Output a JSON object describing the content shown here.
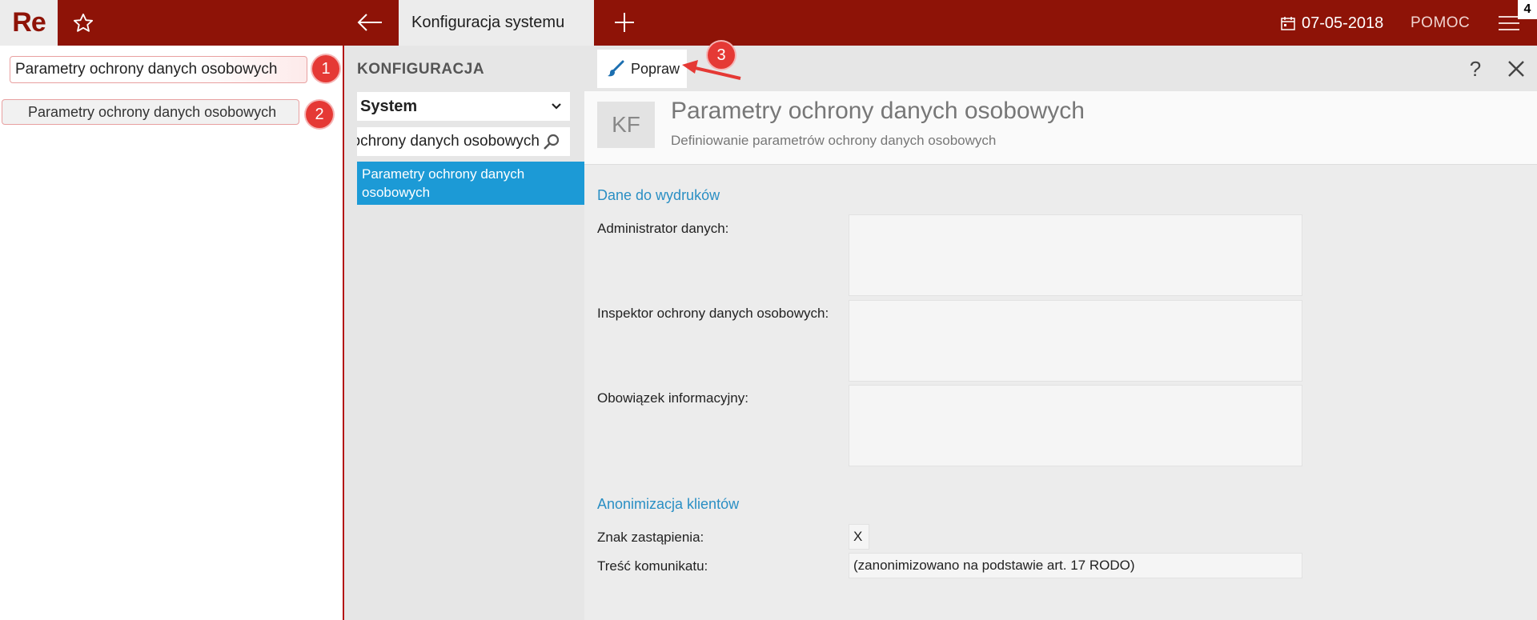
{
  "header": {
    "logo": "Re",
    "active_tab": "Konfiguracja systemu",
    "date": "07-05-2018",
    "help": "POMOC",
    "badge": "4"
  },
  "left": {
    "search_value": "Parametry ochrony danych osobowych",
    "result_item": "Parametry ochrony danych osobowych"
  },
  "steps": [
    "1",
    "2",
    "3"
  ],
  "middle": {
    "title": "KONFIGURACJA",
    "select_value": "System",
    "filter_value": "Parametry ochrony danych osobowych",
    "selected_item": "Parametry ochrony danych osobowych"
  },
  "toolbar": {
    "edit_label": "Popraw",
    "help_label": "?"
  },
  "card": {
    "badge": "KF",
    "title": "Parametry ochrony danych osobowych",
    "subtitle": "Definiowanie parametrów ochrony danych osobowych"
  },
  "form": {
    "section1": "Dane do wydruków",
    "admin_label": "Administrator danych:",
    "admin_value": "",
    "inspector_label": "Inspektor ochrony danych osobowych:",
    "inspector_value": "",
    "duty_label": "Obowiązek informacyjny:",
    "duty_value": "",
    "section2": "Anonimizacja klientów",
    "replace_char_label": "Znak zastąpienia:",
    "replace_char_value": "X",
    "message_label": "Treść komunikatu:",
    "message_value": "(zanonimizowano na podstawie art. 17 RODO)"
  },
  "colors": {
    "brand": "#8e1307",
    "accent": "#1c9ad6",
    "annotation": "#e53935"
  }
}
